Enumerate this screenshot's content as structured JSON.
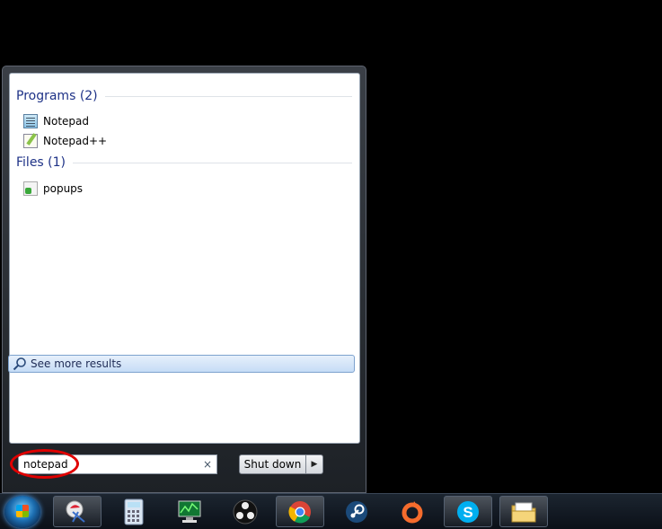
{
  "start_menu": {
    "groups": [
      {
        "title": "Programs (2)",
        "items": [
          {
            "label": "Notepad",
            "icon": "notepad-icon"
          },
          {
            "label": "Notepad++",
            "icon": "notepad-plus-plus-icon"
          }
        ]
      },
      {
        "title": "Files (1)",
        "items": [
          {
            "label": "popups",
            "icon": "file-icon"
          }
        ]
      }
    ],
    "see_more": "See more results",
    "search_value": "notepad",
    "clear_glyph": "×",
    "shutdown_label": "Shut down",
    "shutdown_arrow": "▶"
  },
  "taskbar": {
    "pinned": [
      "snipping-tool-icon",
      "calculator-icon",
      "performance-monitor-icon",
      "obs-icon",
      "chrome-icon",
      "steam-icon",
      "origin-icon",
      "skype-icon",
      "file-explorer-icon"
    ]
  },
  "colors": {
    "group_header": "#1e3287",
    "highlight_ring": "#e00000",
    "chrome_red": "#db4437",
    "steam_blue": "#1b4a7a",
    "origin_orange": "#f56c2d",
    "skype_blue": "#00aff0"
  }
}
